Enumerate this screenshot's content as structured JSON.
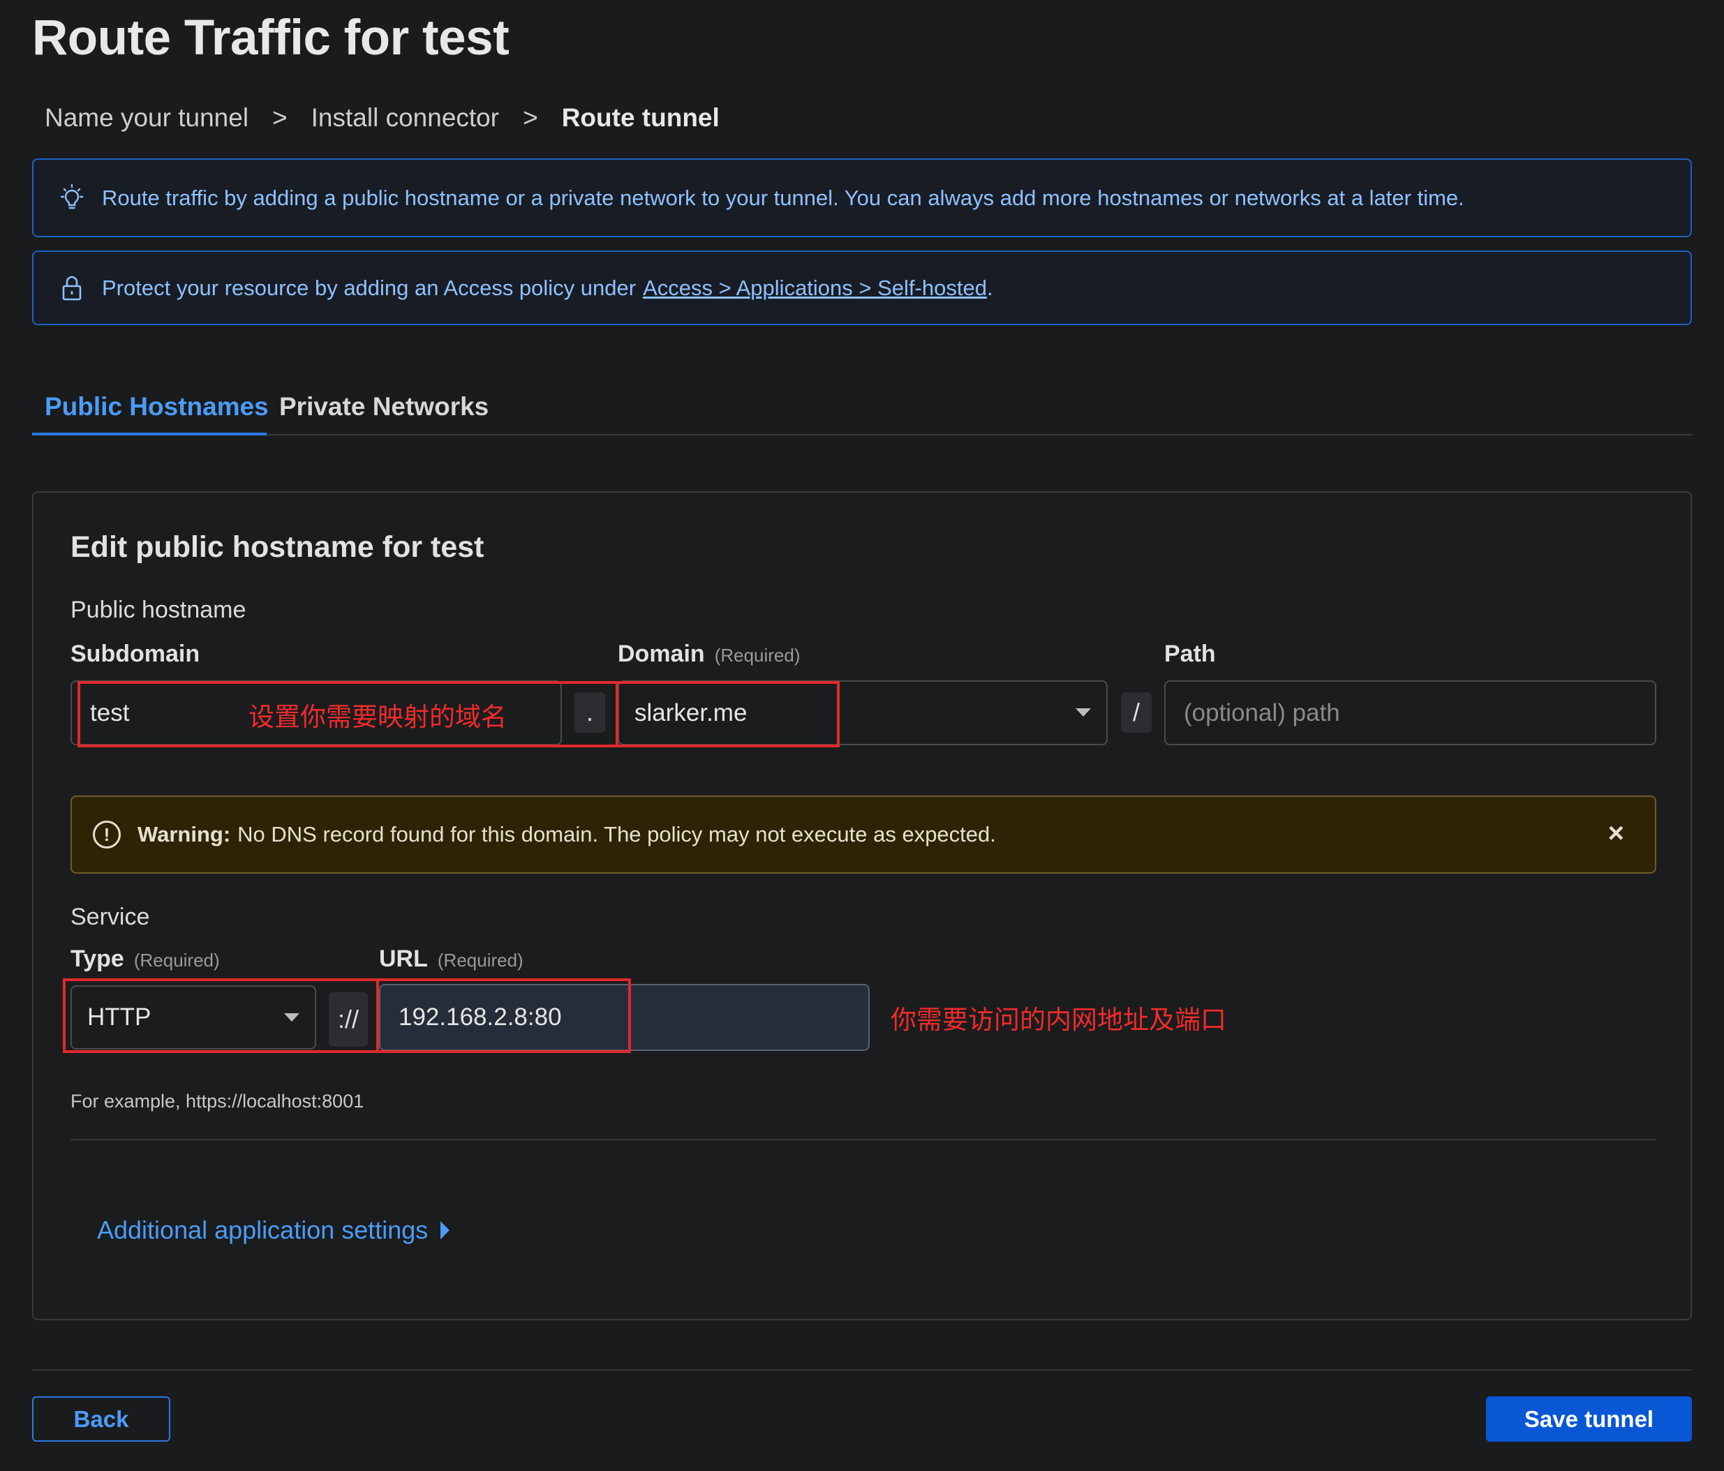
{
  "page": {
    "title": "Route Traffic for test"
  },
  "breadcrumb": {
    "steps": [
      "Name your tunnel",
      "Install connector",
      "Route tunnel"
    ],
    "separator": ">"
  },
  "banners": {
    "info_text": "Route traffic by adding a public hostname or a private network to your tunnel. You can always add more hostnames or networks at a later time.",
    "access_text": "Protect your resource by adding an Access policy under",
    "access_link": "Access > Applications > Self-hosted",
    "access_suffix": "."
  },
  "tabs": {
    "active": "Public Hostnames",
    "inactive": "Private Networks"
  },
  "form": {
    "heading": "Edit public hostname for test",
    "public_hostname_label": "Public hostname",
    "subdomain": {
      "label": "Subdomain",
      "value": "test"
    },
    "dot": ".",
    "domain": {
      "label": "Domain",
      "required": "(Required)",
      "value": "slarker.me"
    },
    "slash": "/",
    "path": {
      "label": "Path",
      "placeholder": "(optional) path"
    },
    "warning": {
      "title": "Warning:",
      "message": "No DNS record found for this domain. The policy may not execute as expected.",
      "close": "×"
    },
    "service_label": "Service",
    "type": {
      "label": "Type",
      "required": "(Required)",
      "value": "HTTP"
    },
    "scheme_sep": "://",
    "url": {
      "label": "URL",
      "required": "(Required)",
      "value": "192.168.2.8:80"
    },
    "help": "For example, https://localhost:8001",
    "additional": "Additional application settings"
  },
  "annotations": {
    "domain_note": "设置你需要映射的域名",
    "url_note": "你需要访问的内网地址及端口",
    "color": "#e02a2a"
  },
  "footer": {
    "back": "Back",
    "save": "Save tunnel"
  },
  "colors": {
    "accent": "#2b78e4",
    "primary_button": "#0a57d6",
    "warning_bg": "#2e2405"
  }
}
